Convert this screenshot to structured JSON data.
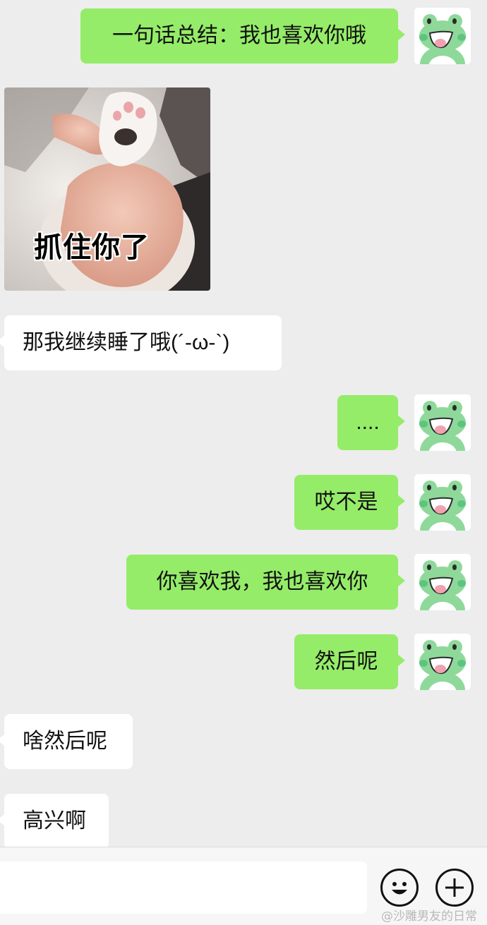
{
  "messages": [
    {
      "side": "out",
      "text": "一句话总结：我也喜欢你哦"
    },
    {
      "side": "in",
      "type": "sticker",
      "caption": "抓住你了"
    },
    {
      "side": "in",
      "text": "那我继续睡了哦(´-ω-`)"
    },
    {
      "side": "out",
      "text": "...."
    },
    {
      "side": "out",
      "text": "哎不是"
    },
    {
      "side": "out",
      "text": "你喜欢我，我也喜欢你"
    },
    {
      "side": "out",
      "text": "然后呢"
    },
    {
      "side": "in",
      "text": "啥然后呢"
    },
    {
      "side": "in",
      "text": "高兴啊"
    }
  ],
  "avatar": {
    "icon": "frog-icon",
    "color": "#8ed99a"
  },
  "input_bar": {
    "value": "",
    "placeholder": ""
  },
  "icons": {
    "emoji": "smiley-icon",
    "more": "plus-circle-icon"
  },
  "watermark": "@沙雕男友的日常",
  "colors": {
    "outgoing_bubble": "#95ec69",
    "incoming_bubble": "#ffffff",
    "background": "#ededed"
  }
}
